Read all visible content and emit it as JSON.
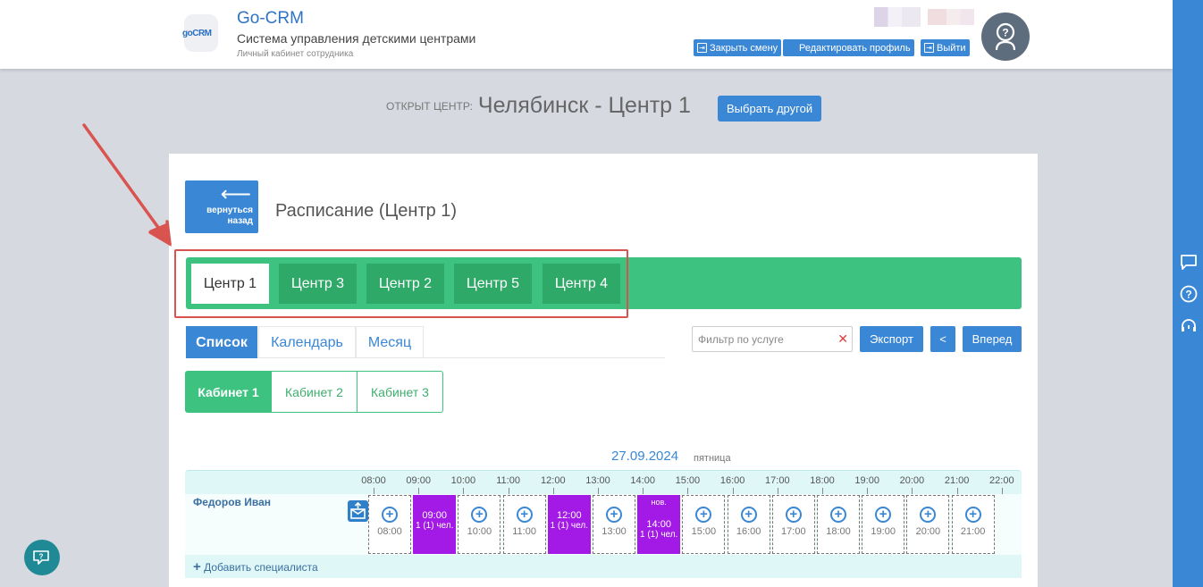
{
  "header": {
    "logo_text": "goCRM",
    "brand": "Go-CRM",
    "subtitle": "Система управления детскими центрами",
    "small_subtitle": "Личный кабинет сотрудника",
    "buttons": {
      "close_shift": "Закрыть смену",
      "edit_profile": "Редактировать профиль",
      "logout": "Выйти"
    }
  },
  "center": {
    "label": "ОТКРЫТ ЦЕНТР:",
    "name": "Челябинск - Центр 1",
    "choose_other": "Выбрать другой"
  },
  "page": {
    "back_label_1": "вернуться",
    "back_label_2": "назад",
    "title": "Расписание (Центр 1)"
  },
  "center_tabs": [
    {
      "label": "Центр 1",
      "active": true
    },
    {
      "label": "Центр 3",
      "active": false
    },
    {
      "label": "Центр 2",
      "active": false
    },
    {
      "label": "Центр 5",
      "active": false
    },
    {
      "label": "Центр 4",
      "active": false
    }
  ],
  "view_tabs": [
    {
      "label": "Список",
      "active": true
    },
    {
      "label": "Календарь",
      "active": false
    },
    {
      "label": "Месяц",
      "active": false
    }
  ],
  "filter": {
    "placeholder": "Фильтр по услуге"
  },
  "controls": {
    "export": "Экспорт",
    "prev": "<",
    "next": "Вперед"
  },
  "rooms": [
    {
      "label": "Кабинет 1",
      "active": true
    },
    {
      "label": "Кабинет 2",
      "active": false
    },
    {
      "label": "Кабинет 3",
      "active": false
    }
  ],
  "schedule": {
    "date": "27.09.2024",
    "weekday": "пятница",
    "hours": [
      "08:00",
      "09:00",
      "10:00",
      "11:00",
      "12:00",
      "13:00",
      "14:00",
      "15:00",
      "16:00",
      "17:00",
      "18:00",
      "19:00",
      "20:00",
      "21:00",
      "22:00"
    ],
    "specialist": "Федоров Иван",
    "slots": [
      {
        "time": "08:00",
        "booked": false
      },
      {
        "time": "09:00",
        "booked": true,
        "info": "1 (1) чел."
      },
      {
        "time": "10:00",
        "booked": false
      },
      {
        "time": "11:00",
        "booked": false
      },
      {
        "time": "12:00",
        "booked": true,
        "info": "1 (1) чел."
      },
      {
        "time": "13:00",
        "booked": false
      },
      {
        "time": "14:00",
        "booked": true,
        "info": "1 (1) чел.",
        "tag": "нов."
      },
      {
        "time": "15:00",
        "booked": false
      },
      {
        "time": "16:00",
        "booked": false
      },
      {
        "time": "17:00",
        "booked": false
      },
      {
        "time": "18:00",
        "booked": false
      },
      {
        "time": "19:00",
        "booked": false
      },
      {
        "time": "20:00",
        "booked": false
      },
      {
        "time": "21:00",
        "booked": false
      }
    ],
    "add_specialist": "Добавить специалиста"
  },
  "colors": {
    "primary": "#3a87d6",
    "green": "#3dc27f",
    "booked": "#a319e6",
    "annotation": "#d9534f"
  }
}
